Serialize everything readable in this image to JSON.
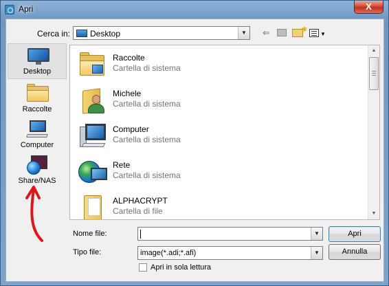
{
  "window": {
    "title": "Apri",
    "close_label": "X"
  },
  "lookin": {
    "label": "Cerca in:",
    "value": "Desktop"
  },
  "toolbar": {
    "back_icon": "back-arrow-icon",
    "up_icon": "up-folder-icon",
    "new_folder_icon": "new-folder-icon",
    "views_icon": "views-menu-icon"
  },
  "places": [
    {
      "label": "Desktop",
      "icon": "desktop-icon",
      "selected": true
    },
    {
      "label": "Raccolte",
      "icon": "libraries-icon"
    },
    {
      "label": "Computer",
      "icon": "computer-icon"
    },
    {
      "label": "Share/NAS",
      "icon": "network-share-icon"
    }
  ],
  "items": [
    {
      "name": "Raccolte",
      "type": "Cartella di sistema",
      "icon": "libraries-folder-icon"
    },
    {
      "name": "Michele",
      "type": "Cartella di sistema",
      "icon": "user-folder-icon"
    },
    {
      "name": "Computer",
      "type": "Cartella di sistema",
      "icon": "computer-icon"
    },
    {
      "name": "Rete",
      "type": "Cartella di sistema",
      "icon": "network-icon"
    },
    {
      "name": "ALPHACRYPT",
      "type": "Cartella di file",
      "icon": "file-folder-icon"
    }
  ],
  "form": {
    "filename_label": "Nome file:",
    "filename_value": "",
    "filetype_label": "Tipo file:",
    "filetype_value": "image(*.adi;*.afi)",
    "readonly_label": "Apri in sola lettura",
    "open_button": "Apri",
    "cancel_button": "Annulla"
  },
  "colors": {
    "annotation_arrow": "#e0151b",
    "title_bar": "#7ea3cb",
    "close_button": "#c1301b"
  }
}
